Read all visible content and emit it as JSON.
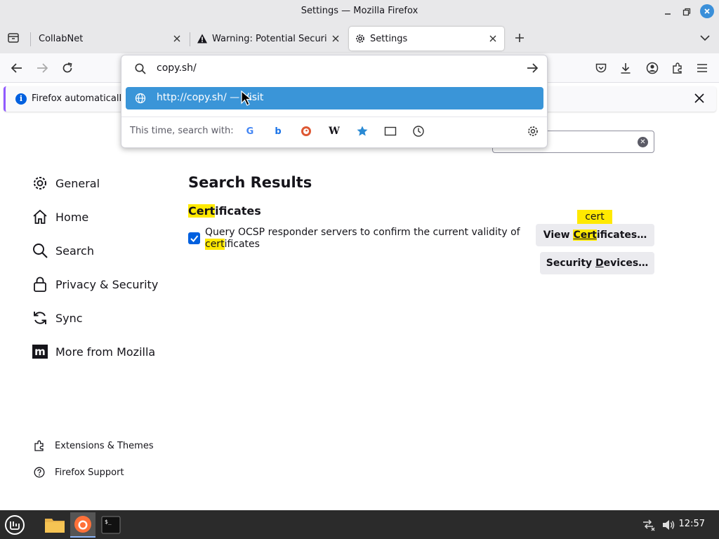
{
  "window": {
    "title": "Settings — Mozilla Firefox"
  },
  "tabs": [
    {
      "label": "CollabNet",
      "active": false
    },
    {
      "label": "Warning: Potential Security",
      "active": false
    },
    {
      "label": "Settings",
      "active": true
    }
  ],
  "notice": {
    "text": "Firefox automatically"
  },
  "urlbar": {
    "value": "copy.sh/",
    "suggestion": "http://copy.sh/ — Visit",
    "search_with_label": "This time, search with:",
    "engines": [
      "google-icon",
      "bing-icon",
      "duckduckgo-icon",
      "wikipedia-icon",
      "bookmarks-icon",
      "tabs-icon",
      "history-icon"
    ]
  },
  "sidebar": {
    "items": [
      {
        "label": "General",
        "icon": "gear-icon"
      },
      {
        "label": "Home",
        "icon": "home-icon"
      },
      {
        "label": "Search",
        "icon": "search-icon"
      },
      {
        "label": "Privacy & Security",
        "icon": "lock-icon"
      },
      {
        "label": "Sync",
        "icon": "sync-icon"
      },
      {
        "label": "More from Mozilla",
        "icon": "mozilla-icon"
      }
    ],
    "footer": [
      {
        "label": "Extensions & Themes",
        "icon": "puzzle-icon"
      },
      {
        "label": "Firefox Support",
        "icon": "help-icon"
      }
    ]
  },
  "main": {
    "results_title": "Search Results",
    "section": {
      "hl": "Cert",
      "rest": "ificates"
    },
    "ocsp": {
      "checked": true,
      "line1": "Query OCSP responder servers to confirm the current validity of",
      "hl": "cert",
      "rest": "ificates"
    },
    "view_cert_button": {
      "pre": "View ",
      "hl": "Cert",
      "rest": "ificates…"
    },
    "security_devices_button": {
      "pre": "Security ",
      "underline": "D",
      "rest": "evices…"
    },
    "tooltip": "cert"
  },
  "taskbar": {
    "clock": "12:57"
  },
  "colors": {
    "accent": "#0060df",
    "highlight": "#ffe900",
    "suggest": "#3a95d8"
  }
}
